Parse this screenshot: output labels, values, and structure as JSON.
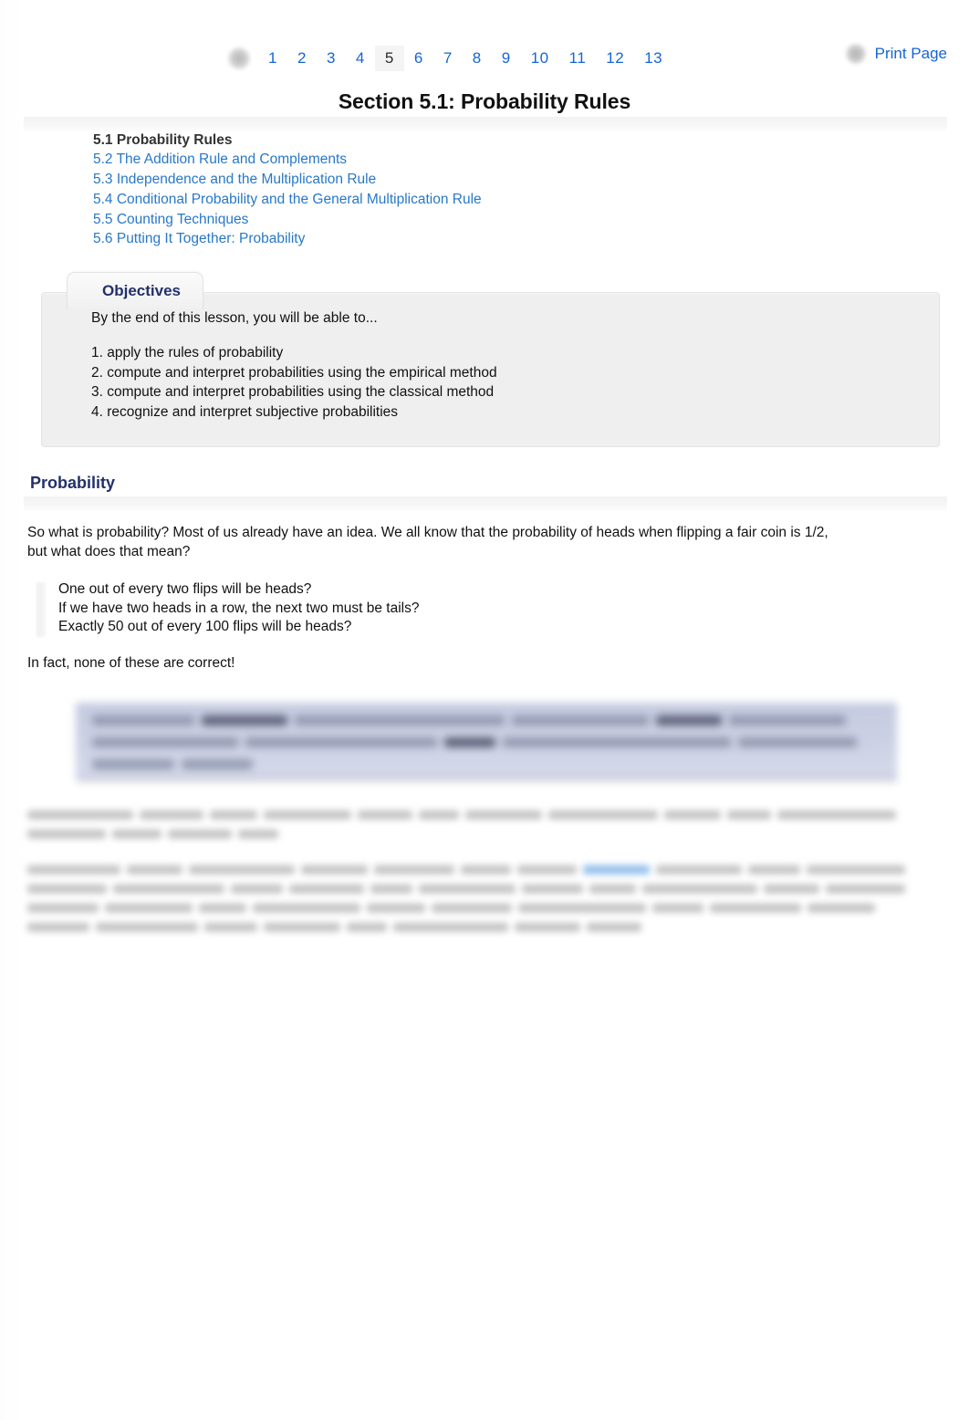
{
  "topnav": {
    "home_icon": "home-icon",
    "pages": [
      {
        "label": "1",
        "current": false
      },
      {
        "label": "2",
        "current": false
      },
      {
        "label": "3",
        "current": false
      },
      {
        "label": "4",
        "current": false
      },
      {
        "label": "5",
        "current": true
      },
      {
        "label": "6",
        "current": false
      },
      {
        "label": "7",
        "current": false
      },
      {
        "label": "8",
        "current": false
      },
      {
        "label": "9",
        "current": false
      },
      {
        "label": "10",
        "current": false
      },
      {
        "label": "11",
        "current": false
      },
      {
        "label": "12",
        "current": false
      },
      {
        "label": "13",
        "current": false
      }
    ],
    "print": {
      "icon": "print-icon",
      "label": "Print Page"
    }
  },
  "title": "Section 5.1: Probability Rules",
  "section_links": [
    {
      "label": "5.1 Probability Rules",
      "current": true
    },
    {
      "label": "5.2 The Addition Rule and Complements",
      "current": false
    },
    {
      "label": "5.3 Independence and the Multiplication Rule",
      "current": false
    },
    {
      "label": "5.4 Conditional Probability and the General Multiplication Rule",
      "current": false
    },
    {
      "label": "5.5 Counting Techniques",
      "current": false
    },
    {
      "label": "5.6 Putting It Together: Probability",
      "current": false
    }
  ],
  "objectives": {
    "tab_label": "Objectives",
    "intro": "By the end of this lesson, you will be able to...",
    "items": [
      "1. apply the rules of probability",
      "2. compute and interpret probabilities using the empirical method",
      "3. compute and interpret probabilities using the classical method",
      "4. recognize and interpret subjective probabilities"
    ]
  },
  "probability_section": {
    "heading": "Probability",
    "intro_paragraph": "So what is probability? Most of us already have an idea. We all know that the probability of heads when flipping a fair coin is 1/2, but what does that mean?",
    "quotes": [
      "One out of every two flips will be heads?",
      "If we have two heads in a row, the next two must be tails?",
      "Exactly 50 out of every 100 flips will be heads?"
    ],
    "conclusion": "In fact, none of these are correct!"
  },
  "colors": {
    "link_blue": "#2878c8",
    "nav_blue": "#1565d8",
    "heading_navy": "#23306b",
    "objectives_bg": "#efefef",
    "callout_bg": "#ccd1e4",
    "text": "#111111"
  }
}
